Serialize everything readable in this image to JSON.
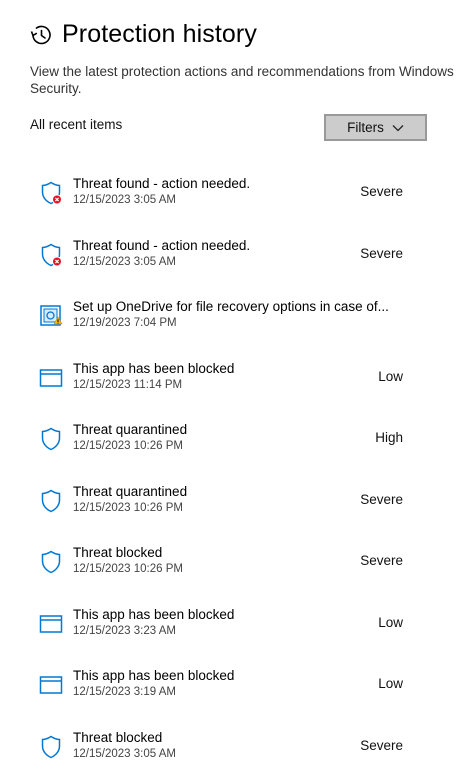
{
  "header": {
    "title": "Protection history",
    "description": "View the latest protection actions and recommendations from Windows Security."
  },
  "filter": {
    "label": "All recent items",
    "button_label": "Filters"
  },
  "items": [
    {
      "title": "Threat found - action needed.",
      "date": "12/15/2023 3:05 AM",
      "severity": "Severe",
      "icon": "shield-error-icon"
    },
    {
      "title": "Threat found - action needed.",
      "date": "12/15/2023 3:05 AM",
      "severity": "Severe",
      "icon": "shield-error-icon"
    },
    {
      "title": "Set up OneDrive for file recovery options in case of...",
      "date": "12/19/2023 7:04 PM",
      "severity": "",
      "icon": "onedrive-warning-icon"
    },
    {
      "title": "This app has been blocked",
      "date": "12/15/2023 11:14 PM",
      "severity": "Low",
      "icon": "app-window-icon"
    },
    {
      "title": "Threat quarantined",
      "date": "12/15/2023 10:26 PM",
      "severity": "High",
      "icon": "shield-icon"
    },
    {
      "title": "Threat quarantined",
      "date": "12/15/2023 10:26 PM",
      "severity": "Severe",
      "icon": "shield-icon"
    },
    {
      "title": "Threat blocked",
      "date": "12/15/2023 10:26 PM",
      "severity": "Severe",
      "icon": "shield-icon"
    },
    {
      "title": "This app has been blocked",
      "date": "12/15/2023 3:23 AM",
      "severity": "Low",
      "icon": "app-window-icon"
    },
    {
      "title": "This app has been blocked",
      "date": "12/15/2023 3:19 AM",
      "severity": "Low",
      "icon": "app-window-icon"
    },
    {
      "title": "Threat blocked",
      "date": "12/15/2023 3:05 AM",
      "severity": "Severe",
      "icon": "shield-icon"
    }
  ],
  "colors": {
    "accent": "#0078d4",
    "error": "#e81123",
    "warning": "#ffb900",
    "button_bg": "#cccccc",
    "button_border": "#999999"
  }
}
